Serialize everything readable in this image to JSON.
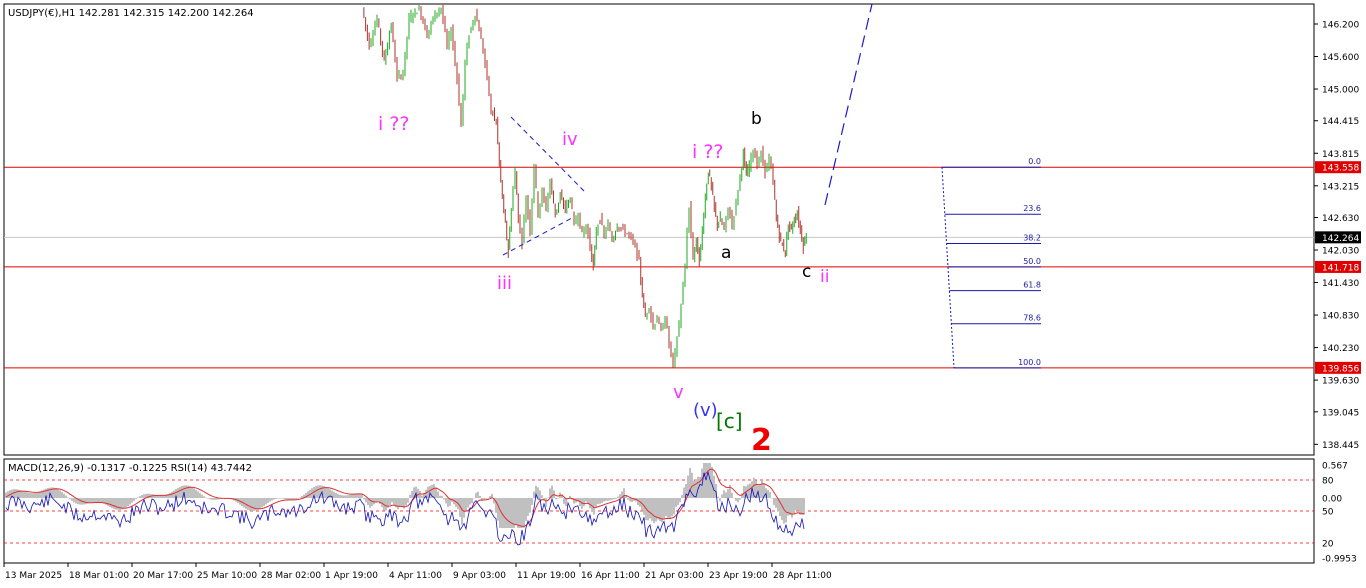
{
  "header": {
    "symbol_line": "USDJPY(€),H1  142.281 142.315 142.200 142.264",
    "indicator_line": "MACD(12,26,9) -0.1317 -0.1225 RSI(14) 43.7442"
  },
  "chart_data": {
    "type": "line",
    "title": "USDJPY(€),H1",
    "ohlc_current": {
      "open": 142.281,
      "high": 142.315,
      "low": 142.2,
      "close": 142.264
    },
    "price_axis": {
      "ylim": [
        138.445,
        146.5
      ],
      "ticks": [
        "146.200",
        "145.600",
        "145.000",
        "144.415",
        "143.815",
        "143.215",
        "142.630",
        "142.030",
        "141.430",
        "140.830",
        "140.230",
        "139.630",
        "139.045",
        "138.445"
      ]
    },
    "time_axis": {
      "ticks": [
        "13 Mar 2025",
        "18 Mar 01:00",
        "20 Mar 17:00",
        "25 Mar 10:00",
        "28 Mar 02:00",
        "1 Apr 19:00",
        "4 Apr 11:00",
        "9 Apr 03:00",
        "11 Apr 19:00",
        "16 Apr 11:00",
        "21 Apr 03:00",
        "23 Apr 19:00",
        "28 Apr 11:00"
      ]
    },
    "price_path": [
      [
        363,
        146.5
      ],
      [
        370,
        145.8
      ],
      [
        378,
        146.3
      ],
      [
        385,
        145.5
      ],
      [
        392,
        146.2
      ],
      [
        398,
        145.2
      ],
      [
        404,
        145.3
      ],
      [
        410,
        146.3
      ],
      [
        420,
        146.5
      ],
      [
        428,
        146.0
      ],
      [
        436,
        146.4
      ],
      [
        442,
        146.5
      ],
      [
        448,
        145.8
      ],
      [
        452,
        146.1
      ],
      [
        458,
        145.2
      ],
      [
        462,
        144.3
      ],
      [
        466,
        145.5
      ],
      [
        470,
        146.0
      ],
      [
        476,
        146.4
      ],
      [
        480,
        146.1
      ],
      [
        484,
        145.7
      ],
      [
        488,
        145.2
      ],
      [
        492,
        144.6
      ],
      [
        497,
        144.4
      ],
      [
        500,
        143.6
      ],
      [
        503,
        143.0
      ],
      [
        506,
        142.5
      ],
      [
        509,
        142.0
      ],
      [
        512,
        142.8
      ],
      [
        516,
        143.5
      ],
      [
        519,
        142.6
      ],
      [
        523,
        142.2
      ],
      [
        527,
        143.0
      ],
      [
        531,
        142.4
      ],
      [
        535,
        143.6
      ],
      [
        539,
        142.7
      ],
      [
        543,
        143.1
      ],
      [
        547,
        142.8
      ],
      [
        551,
        143.3
      ],
      [
        556,
        142.7
      ],
      [
        561,
        143.0
      ],
      [
        566,
        142.8
      ],
      [
        571,
        143.0
      ],
      [
        575,
        142.5
      ],
      [
        579,
        142.7
      ],
      [
        583,
        142.3
      ],
      [
        587,
        142.5
      ],
      [
        591,
        142.1
      ],
      [
        594,
        141.7
      ],
      [
        597,
        142.4
      ],
      [
        601,
        142.6
      ],
      [
        605,
        142.3
      ],
      [
        609,
        142.5
      ],
      [
        613,
        142.2
      ],
      [
        618,
        142.5
      ],
      [
        624,
        142.4
      ],
      [
        630,
        142.3
      ],
      [
        636,
        142.1
      ],
      [
        640,
        141.8
      ],
      [
        643,
        141.2
      ],
      [
        646,
        140.8
      ],
      [
        650,
        141.0
      ],
      [
        654,
        140.6
      ],
      [
        658,
        140.8
      ],
      [
        662,
        140.5
      ],
      [
        666,
        140.8
      ],
      [
        670,
        140.3
      ],
      [
        674,
        139.9
      ],
      [
        678,
        140.4
      ],
      [
        682,
        141.0
      ],
      [
        686,
        141.7
      ],
      [
        688,
        142.4
      ],
      [
        690,
        142.8
      ],
      [
        692,
        142.3
      ],
      [
        694,
        141.9
      ],
      [
        697,
        142.2
      ],
      [
        700,
        141.8
      ],
      [
        703,
        142.4
      ],
      [
        706,
        143.0
      ],
      [
        709,
        143.5
      ],
      [
        712,
        143.2
      ],
      [
        715,
        142.8
      ],
      [
        718,
        142.5
      ],
      [
        721,
        142.6
      ],
      [
        725,
        142.4
      ],
      [
        729,
        142.8
      ],
      [
        733,
        142.5
      ],
      [
        737,
        142.9
      ],
      [
        741,
        143.4
      ],
      [
        744,
        143.8
      ],
      [
        747,
        143.4
      ],
      [
        750,
        143.6
      ],
      [
        754,
        143.9
      ],
      [
        758,
        143.6
      ],
      [
        762,
        143.8
      ],
      [
        766,
        143.5
      ],
      [
        770,
        143.7
      ],
      [
        774,
        143.3
      ],
      [
        777,
        142.6
      ],
      [
        780,
        142.3
      ],
      [
        783,
        142.1
      ],
      [
        786,
        142.0
      ],
      [
        789,
        142.5
      ],
      [
        792,
        142.4
      ],
      [
        795,
        142.6
      ],
      [
        798,
        142.7
      ],
      [
        801,
        142.4
      ],
      [
        804,
        142.1
      ],
      [
        807,
        142.3
      ]
    ],
    "horizontal_levels": [
      {
        "price": 143.558,
        "label": "143.558",
        "color": "#e00000"
      },
      {
        "price": 141.718,
        "label": "141.718",
        "color": "#e00000"
      },
      {
        "price": 139.856,
        "label": "139.856",
        "color": "#e00000"
      },
      {
        "price": 142.264,
        "label": "142.264",
        "color": "#000000"
      }
    ],
    "fibonacci": {
      "levels": [
        {
          "pct": "0.0",
          "price": 143.558
        },
        {
          "pct": "23.6",
          "price": 142.69
        },
        {
          "pct": "38.2",
          "price": 142.15
        },
        {
          "pct": "50.0",
          "price": 141.718
        },
        {
          "pct": "61.8",
          "price": 141.28
        },
        {
          "pct": "78.6",
          "price": 140.67
        },
        {
          "pct": "100.0",
          "price": 139.856
        }
      ],
      "color": "#1a1aa6"
    },
    "wave_labels": [
      {
        "text": "i ??",
        "color": "#ff33ff"
      },
      {
        "text": "iii",
        "color": "#ff33ff"
      },
      {
        "text": "iv",
        "color": "#ff33ff"
      },
      {
        "text": "v",
        "color": "#ff33ff"
      },
      {
        "text": "(v)",
        "color": "#3333ff"
      },
      {
        "text": "[c]",
        "color": "#007a00"
      },
      {
        "text": "2",
        "color": "#ee0000"
      },
      {
        "text": "i ??",
        "color": "#ff33ff"
      },
      {
        "text": "a",
        "color": "#000000"
      },
      {
        "text": "b",
        "color": "#000000"
      },
      {
        "text": "c",
        "color": "#000000"
      },
      {
        "text": "ii",
        "color": "#ff33ff"
      }
    ],
    "indicator_axis": {
      "ticks": [
        "0.567",
        "80",
        "0.00",
        "50",
        "20",
        "-0.9953"
      ]
    },
    "colors": {
      "bull_candle": "#1fa81f",
      "bear_candle": "#b0302a",
      "macd_histogram": "#c0c0c0",
      "macd_signal": "#e03030",
      "rsi": "#1010c0",
      "level_line": "#e00000",
      "projection": "#1a1ad0"
    }
  }
}
